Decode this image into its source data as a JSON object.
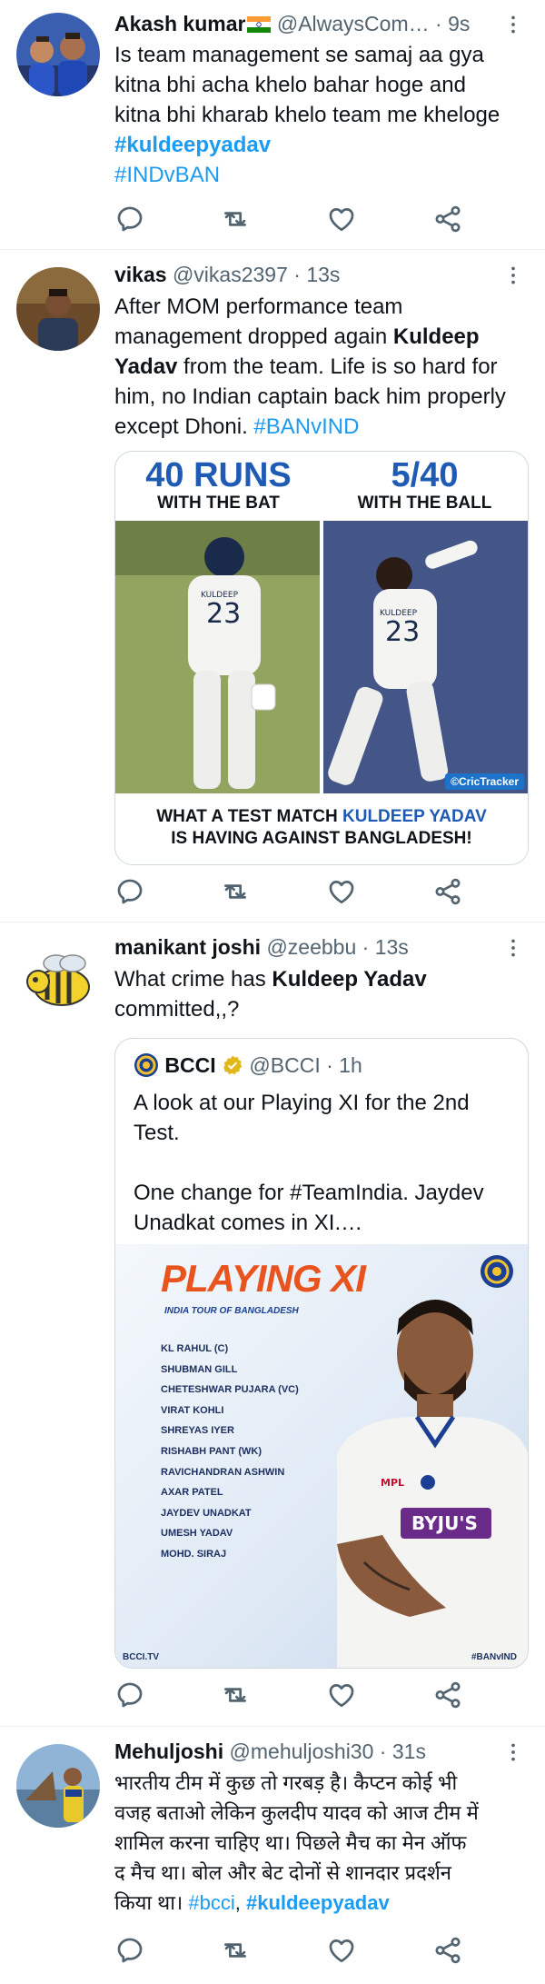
{
  "tweets": [
    {
      "name": "Akash kumar",
      "handle": "@AlwaysCom…",
      "time": "9s",
      "text_lines": [
        "Is team management se samaj aa gya",
        "kitna bhi acha khelo bahar hoge and",
        "kitna bhi kharab khelo team me kheloge"
      ],
      "hashtags": [
        "#kuldeepyadav",
        "#INDvBAN"
      ]
    },
    {
      "name": "vikas",
      "handle": "@vikas2397",
      "time": "13s",
      "text": {
        "l1": "After MOM performance team",
        "l2a": "management dropped again ",
        "l2b": "Kuldeep",
        "l3a": "Yadav",
        "l3b": " from the team. Life is so hard for",
        "l4": "him, no Indian captain back him properly",
        "l5a": "except Dhoni. ",
        "l5b": "#BANvIND"
      },
      "image": {
        "left_big": "40 RUNS",
        "left_small": "WITH THE BAT",
        "right_big": "5/40",
        "right_small": "WITH THE BALL",
        "jersey_left": "KULDEEP",
        "jersey_number": "23",
        "jersey_right": "KULDEEP",
        "watermark": "CricTracker",
        "footer_a": "WHAT A TEST MATCH ",
        "footer_b": "KULDEEP YADAV",
        "footer_c": "IS HAVING AGAINST BANGLADESH!"
      }
    },
    {
      "name": "manikant joshi",
      "handle": "@zeebbu",
      "time": "13s",
      "text": {
        "l1a": "What crime has ",
        "l1b": "Kuldeep Yadav",
        "l2": "committed,,?"
      },
      "quote": {
        "name": "BCCI",
        "handle": "@BCCI",
        "time": "1h",
        "lines": [
          "A look at our Playing XI for the 2nd",
          "Test.",
          "",
          "One change for #TeamIndia. Jaydev",
          "Unadkat comes in XI.…"
        ],
        "image": {
          "title": "PLAYING XI",
          "subtitle": "INDIA TOUR OF BANGLADESH",
          "players": [
            "KL RAHUL (C)",
            "SHUBMAN GILL",
            "CHETESHWAR PUJARA (VC)",
            "VIRAT KOHLI",
            "SHREYAS IYER",
            "RISHABH PANT (WK)",
            "RAVICHANDRAN ASHWIN",
            "AXAR PATEL",
            "JAYDEV UNADKAT",
            "UMESH YADAV",
            "MOHD. SIRAJ"
          ],
          "footer_left": "BCCI.TV",
          "footer_right": "#BANvIND",
          "shirt_brand": "BYJU'S",
          "shirt_sponsor": "MPL"
        }
      }
    },
    {
      "name": "Mehuljoshi",
      "handle": "@mehuljoshi30",
      "time": "31s",
      "text_lines": [
        "भारतीय टीम में कुछ तो गरबड़ है। कैप्टन कोई भी",
        "वजह बताओ लेकिन कुलदीप यादव को आज टीम में",
        "शामिल करना चाहिए था। पिछले मैच का मेन ऑफ",
        "द मैच था। बोल और बेट दोनों से शानदार प्रदर्शन"
      ],
      "last_line": {
        "text": "किया था। ",
        "tag1": "#bcci",
        "sep": ", ",
        "tag2": "#kuldeepyadav"
      }
    }
  ],
  "separator": "·",
  "colors": {
    "accent": "#1d9bf0",
    "secondary_text": "#536471",
    "border": "#eff3f4",
    "verified": "#e2b719"
  },
  "icons": [
    "reply-icon",
    "retweet-icon",
    "like-icon",
    "share-icon",
    "more-icon",
    "verified-badge-icon",
    "india-flag-icon"
  ]
}
